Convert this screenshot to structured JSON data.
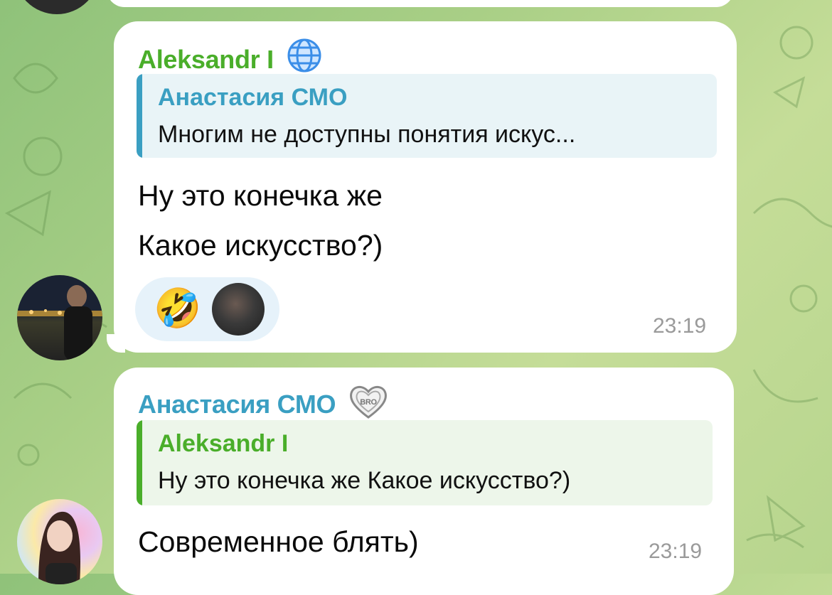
{
  "messages": [
    {
      "sender": "Aleksandr I",
      "sender_color": "#4aae2a",
      "badge_icon": "globe-icon",
      "reply": {
        "name": "Анастасия СМО",
        "text": "Многим не доступны понятия искус...",
        "accent": "#3a9fc2",
        "bg": "#e9f4f7"
      },
      "lines": [
        "Ну это конечка же",
        "Какое искусство?)"
      ],
      "reactions": {
        "emoji": "🤣"
      },
      "time": "23:19"
    },
    {
      "sender": "Анастасия СМО",
      "sender_color": "#3a9fc2",
      "badge_icon": "heart-badge-icon",
      "reply": {
        "name": "Aleksandr I",
        "text": "Ну это конечка же Какое искусство?)",
        "accent": "#4aae2a",
        "bg": "#edf6ea"
      },
      "lines": [
        "Современное блять)"
      ],
      "time": "23:19"
    }
  ]
}
